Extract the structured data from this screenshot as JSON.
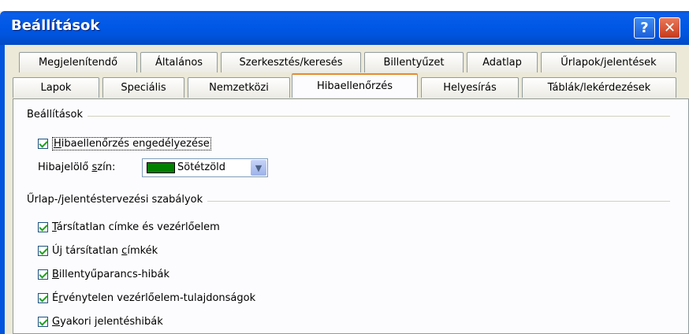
{
  "window": {
    "title": "Beállítások",
    "help_glyph": "?",
    "close_glyph": "✕"
  },
  "tabs": {
    "row1": [
      "Megjelenítendő",
      "Általános",
      "Szerkesztés/keresés",
      "Billentyűzet",
      "Adatlap",
      "Űrlapok/jelentések"
    ],
    "row2": [
      "Lapok",
      "Speciális",
      "Nemzetközi",
      "Hibaellenőrzés",
      "Helyesírás",
      "Táblák/lekérdezések"
    ],
    "active": "Hibaellenőrzés"
  },
  "settings_group": {
    "label": "Beállítások",
    "enable_checking": {
      "label_underlined": "H",
      "label_rest": "ibaellenőrzés engedélyezése",
      "checked": true
    },
    "indicator_color": {
      "label_pre": "Hibajelölő ",
      "label_underlined": "s",
      "label_post": "zín:",
      "value": "Sötétzöld",
      "swatch_color": "#008000"
    }
  },
  "rules_group": {
    "label": "Űrlap-/jelentéstervezési szabályok",
    "items": [
      {
        "pre": "",
        "u": "T",
        "post": "ársítatlan címke és vezérlőelem",
        "checked": true
      },
      {
        "pre": "Új társítatlan ",
        "u": "c",
        "post": "ímkék",
        "checked": true
      },
      {
        "pre": "",
        "u": "B",
        "post": "illentyűparancs-hibák",
        "checked": true
      },
      {
        "pre": "É",
        "u": "r",
        "post": "vénytelen vezérlőelem-tulajdonságok",
        "checked": true
      },
      {
        "pre": "",
        "u": "G",
        "post": "yakori jelentéshibák",
        "checked": true
      }
    ]
  },
  "colors": {
    "titlebar": "#0054dd",
    "active_tab_accent": "#e68b2c",
    "checkmark": "#21a121"
  }
}
